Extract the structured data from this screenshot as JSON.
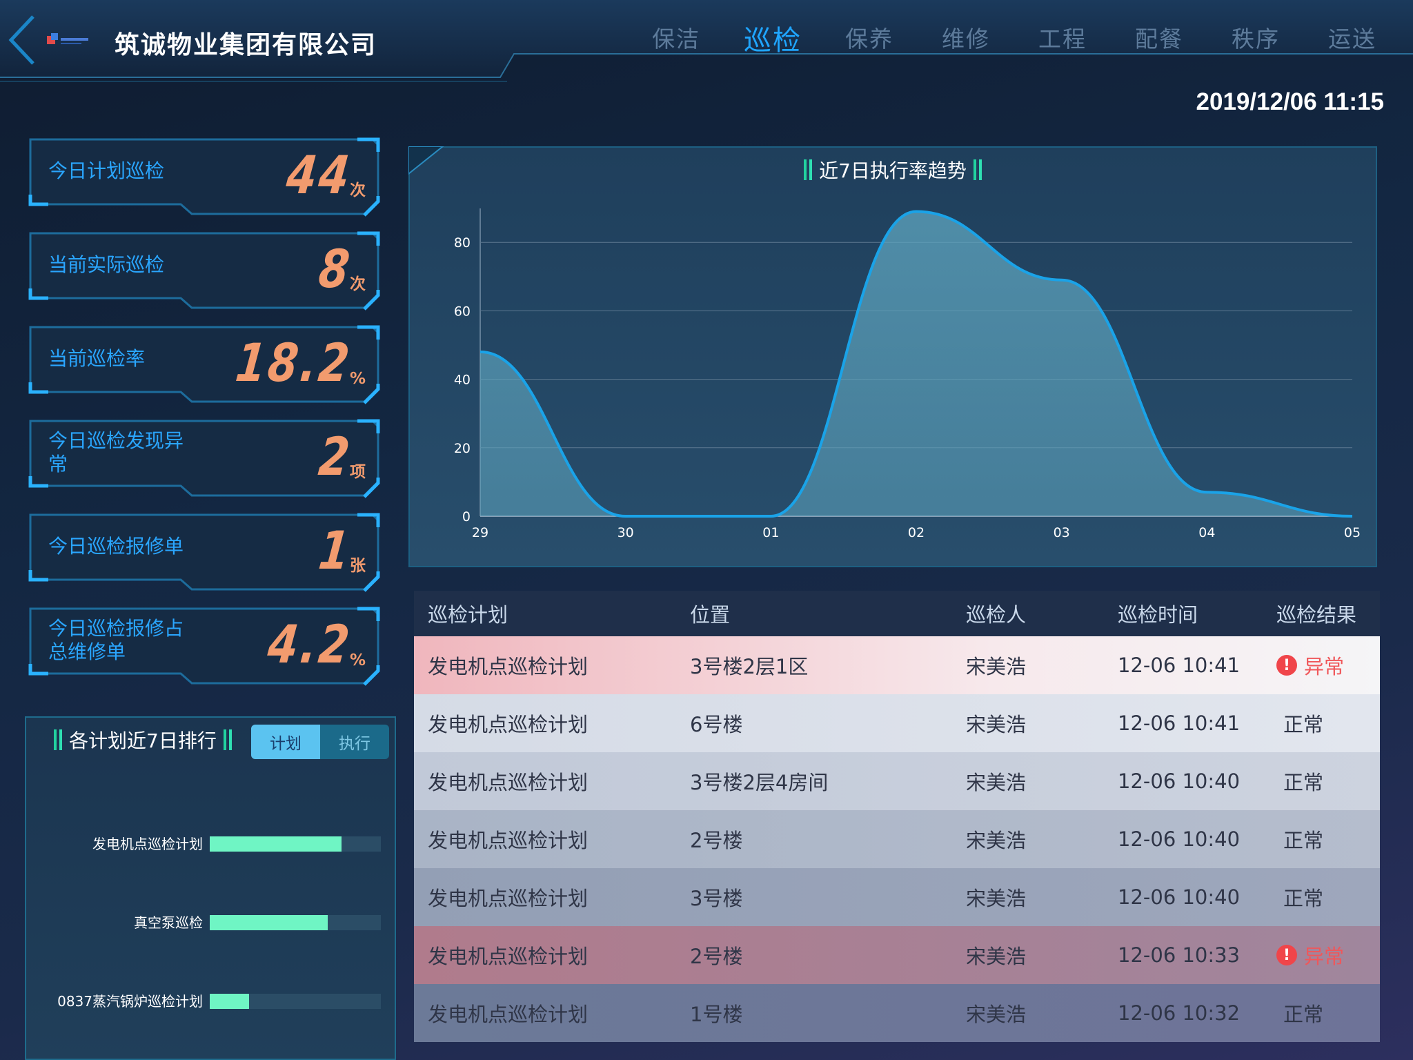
{
  "header": {
    "company_name": "筑诚物业集团有限公司",
    "nav": [
      {
        "label": "保洁",
        "active": false
      },
      {
        "label": "巡检",
        "active": true
      },
      {
        "label": "保养",
        "active": false
      },
      {
        "label": "维修",
        "active": false
      },
      {
        "label": "工程",
        "active": false
      },
      {
        "label": "配餐",
        "active": false
      },
      {
        "label": "秩序",
        "active": false
      },
      {
        "label": "运送",
        "active": false
      }
    ],
    "datetime": "2019/12/06 11:15"
  },
  "stats": [
    {
      "label": "今日计划巡检",
      "value": "44",
      "unit": "次"
    },
    {
      "label": "当前实际巡检",
      "value": "8",
      "unit": "次"
    },
    {
      "label": "当前巡检率",
      "value": "18.2",
      "unit": "%"
    },
    {
      "label": "今日巡检发现异常",
      "value": "2",
      "unit": "项"
    },
    {
      "label": "今日巡检报修单",
      "value": "1",
      "unit": "张"
    },
    {
      "label": "今日巡检报修占总维修单",
      "value": "4.2",
      "unit": "%"
    }
  ],
  "ranking": {
    "title": "各计划近7日排行",
    "toggle": {
      "plan": "计划",
      "exec": "执行",
      "selected": "plan"
    },
    "items": [
      {
        "name": "发电机点巡检计划",
        "fraction": 0.77
      },
      {
        "name": "真空泵巡检",
        "fraction": 0.69
      },
      {
        "name": "0837蒸汽锅炉巡检计划",
        "fraction": 0.23
      }
    ]
  },
  "chart_data": {
    "type": "area",
    "title": "近7日执行率趋势",
    "categories": [
      "29",
      "30",
      "01",
      "02",
      "03",
      "04",
      "05"
    ],
    "values": [
      48,
      0,
      0,
      89,
      69,
      7,
      0
    ],
    "y_ticks": [
      "0",
      "20",
      "40",
      "60",
      "80"
    ],
    "ylim": [
      0,
      100
    ],
    "grid": true,
    "line_color": "#1aa3e8",
    "fill_color": "#5fa6c0"
  },
  "table": {
    "headers": [
      "巡检计划",
      "位置",
      "巡检人",
      "巡检时间",
      "巡检结果"
    ],
    "rows": [
      {
        "plan": "发电机点巡检计划",
        "location": "3号楼2层1区",
        "inspector": "宋美浩",
        "time": "12-06 10:41",
        "result": "异常",
        "abnormal": true
      },
      {
        "plan": "发电机点巡检计划",
        "location": "6号楼",
        "inspector": "宋美浩",
        "time": "12-06 10:41",
        "result": "正常",
        "abnormal": false
      },
      {
        "plan": "发电机点巡检计划",
        "location": "3号楼2层4房间",
        "inspector": "宋美浩",
        "time": "12-06 10:40",
        "result": "正常",
        "abnormal": false
      },
      {
        "plan": "发电机点巡检计划",
        "location": "2号楼",
        "inspector": "宋美浩",
        "time": "12-06 10:40",
        "result": "正常",
        "abnormal": false
      },
      {
        "plan": "发电机点巡检计划",
        "location": "3号楼",
        "inspector": "宋美浩",
        "time": "12-06 10:40",
        "result": "正常",
        "abnormal": false
      },
      {
        "plan": "发电机点巡检计划",
        "location": "2号楼",
        "inspector": "宋美浩",
        "time": "12-06 10:33",
        "result": "异常",
        "abnormal": true
      },
      {
        "plan": "发电机点巡检计划",
        "location": "1号楼",
        "inspector": "宋美浩",
        "time": "12-06 10:32",
        "result": "正常",
        "abnormal": false
      }
    ]
  },
  "colors": {
    "accent_blue": "#1fa5ff",
    "stat_orange": "#f29b6e",
    "bar_green": "#6ff5c4",
    "abnormal_red": "#f0454a"
  }
}
